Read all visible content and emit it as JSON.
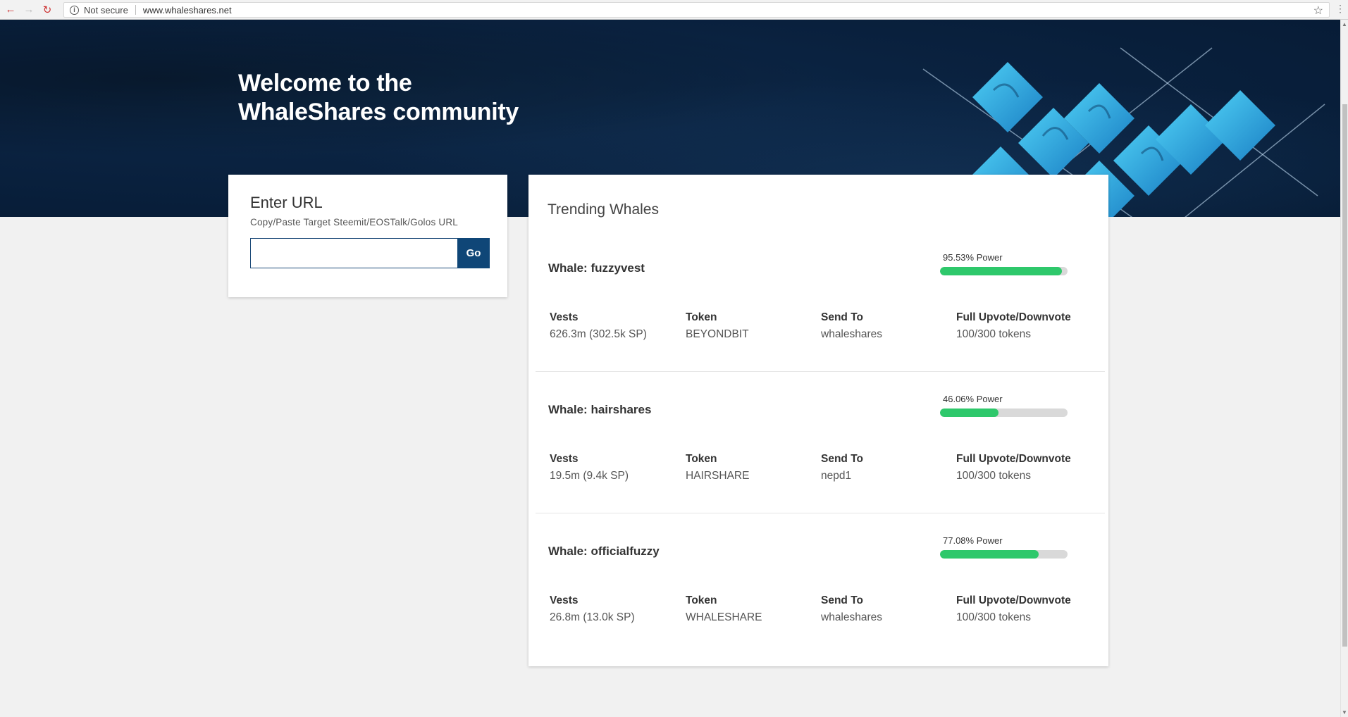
{
  "browser": {
    "security_label": "Not secure",
    "url": "www.whaleshares.net"
  },
  "hero": {
    "title_line1": "Welcome to the",
    "title_line2": "WhaleShares community"
  },
  "url_card": {
    "title": "Enter URL",
    "subtitle": "Copy/Paste Target Steemit/EOSTalk/Golos URL",
    "input_value": "",
    "go_label": "Go"
  },
  "trending": {
    "title": "Trending Whales",
    "column_labels": {
      "vests": "Vests",
      "token": "Token",
      "send_to": "Send To",
      "upvote": "Full Upvote/Downvote"
    },
    "whales": [
      {
        "name": "Whale: fuzzyvest",
        "power_label": "95.53% Power",
        "power": 95.53,
        "vests": "626.3m (302.5k SP)",
        "token": "BEYONDBIT",
        "send_to": "whaleshares",
        "upvote": "100/300 tokens"
      },
      {
        "name": "Whale: hairshares",
        "power_label": "46.06% Power",
        "power": 46.06,
        "vests": "19.5m (9.4k SP)",
        "token": "HAIRSHARE",
        "send_to": "nepd1",
        "upvote": "100/300 tokens"
      },
      {
        "name": "Whale: officialfuzzy",
        "power_label": "77.08% Power",
        "power": 77.08,
        "vests": "26.8m (13.0k SP)",
        "token": "WHALESHARE",
        "send_to": "whaleshares",
        "upvote": "100/300 tokens"
      }
    ]
  },
  "colors": {
    "hero_bg": "#0a2240",
    "go_button": "#0f4677",
    "power_fill": "#2ec86b",
    "power_track": "#d9d9d9"
  }
}
